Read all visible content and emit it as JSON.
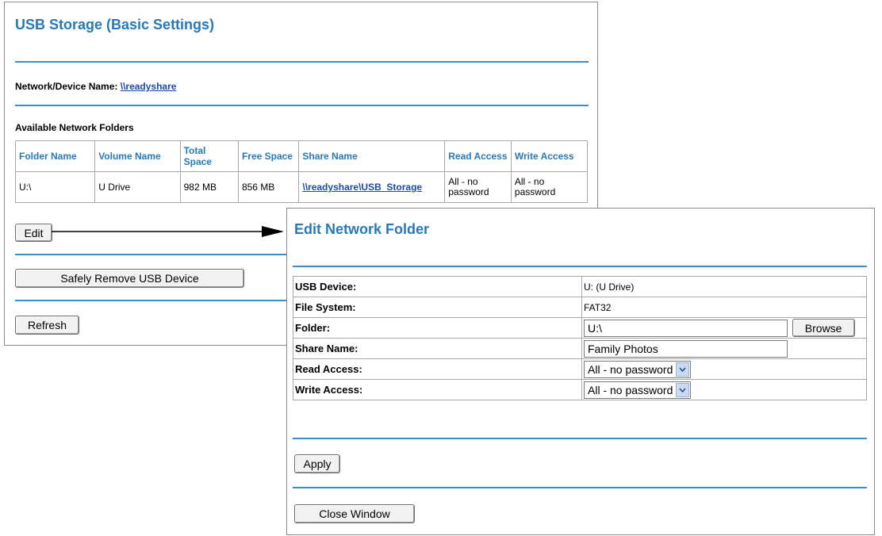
{
  "usb_storage": {
    "title": "USB Storage (Basic Settings)",
    "network_device_label": "Network/Device Name:",
    "network_device_link": "\\\\readyshare",
    "available_folders_label": "Available Network Folders",
    "columns": [
      "Folder Name",
      "Volume Name",
      "Total Space",
      "Free Space",
      "Share Name",
      "Read Access",
      "Write Access"
    ],
    "rows": [
      {
        "folder_name": "U:\\",
        "volume_name": "U Drive",
        "total_space": "982 MB",
        "free_space": "856 MB",
        "share_name": "\\\\readyshare\\USB_Storage",
        "read_access": "All - no password",
        "write_access": "All - no password"
      }
    ],
    "edit_button": "Edit",
    "safely_remove_button": "Safely Remove USB Device",
    "refresh_button": "Refresh"
  },
  "edit_folder": {
    "title": "Edit Network Folder",
    "usb_device_label": "USB Device:",
    "usb_device_value": "U: (U Drive)",
    "file_system_label": "File System:",
    "file_system_value": "FAT32",
    "folder_label": "Folder:",
    "folder_value": "U:\\",
    "browse_button": "Browse",
    "share_name_label": "Share Name:",
    "share_name_value": "Family Photos",
    "read_access_label": "Read Access:",
    "read_access_value": "All - no password",
    "write_access_label": "Write Access:",
    "write_access_value": "All - no password",
    "apply_button": "Apply",
    "close_button": "Close Window"
  },
  "colors": {
    "title_blue": "#2779b9",
    "rule_blue": "#3c8ec9",
    "link_blue": "#1e4aa8"
  }
}
